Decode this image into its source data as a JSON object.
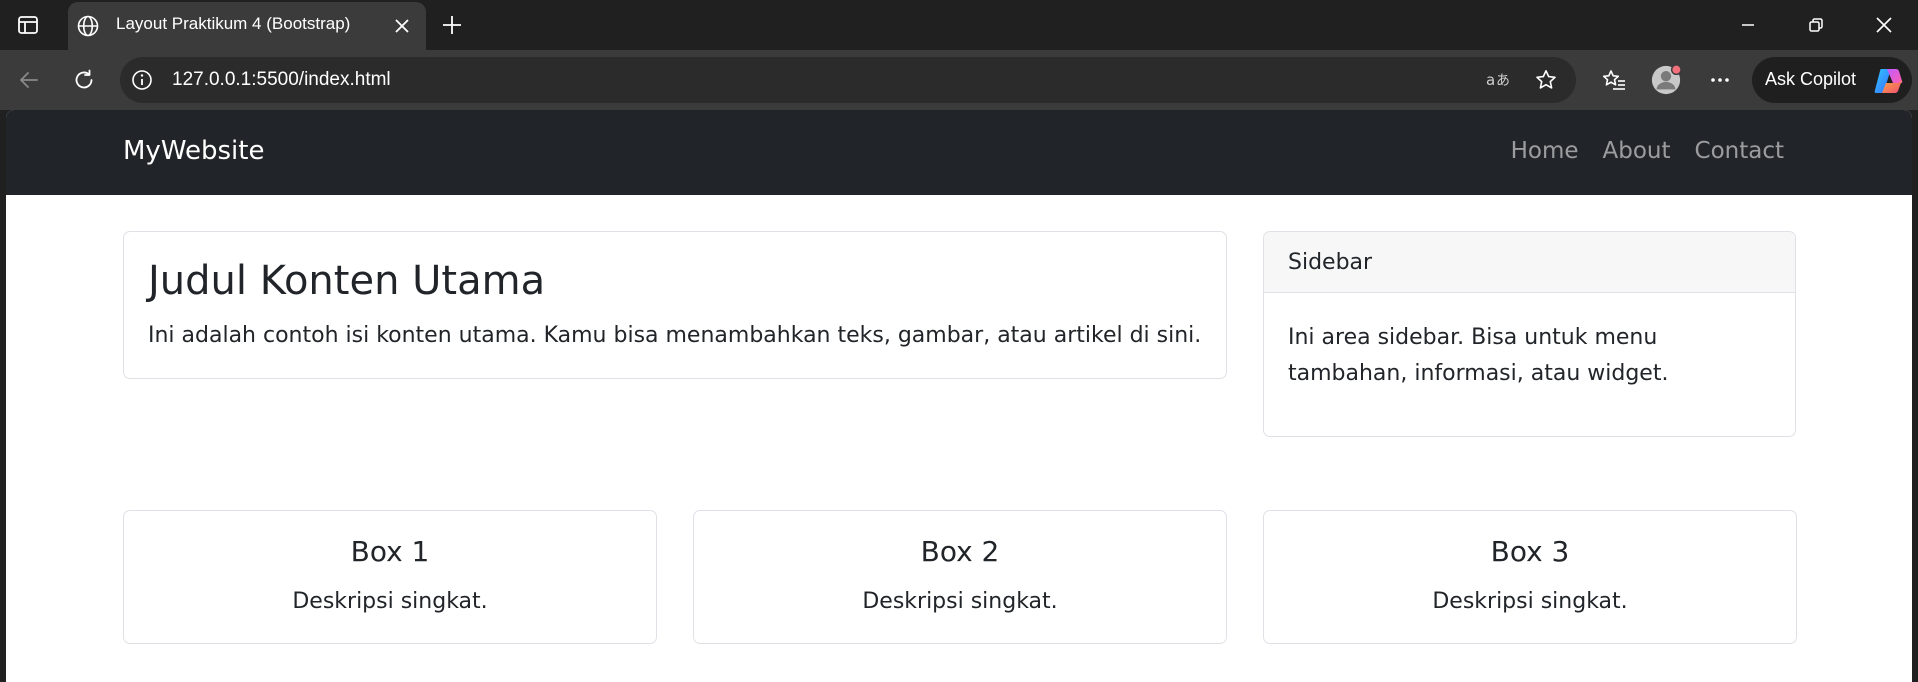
{
  "browser": {
    "tab_title": "Layout Praktikum 4 (Bootstrap)",
    "url": "127.0.0.1:5500/index.html",
    "copilot_label": "Ask Copilot",
    "icons": [
      "tab-actions-icon",
      "globe-icon",
      "close-icon",
      "plus-icon",
      "minimize-icon",
      "restore-icon",
      "window-close-icon",
      "back-icon",
      "refresh-icon",
      "info-icon",
      "read-aloud-icon",
      "favorite-star-icon",
      "favorites-icon",
      "profile-icon",
      "more-icon",
      "copilot-icon"
    ]
  },
  "navbar": {
    "brand": "MyWebsite",
    "links": [
      "Home",
      "About",
      "Contact"
    ],
    "bg_color": "#212529"
  },
  "main": {
    "title": "Judul Konten Utama",
    "text": "Ini adalah contoh isi konten utama. Kamu bisa menambahkan teks, gambar, atau artikel di sini."
  },
  "sidebar": {
    "header": "Sidebar",
    "text": "Ini area sidebar. Bisa untuk menu tambahan, informasi, atau widget."
  },
  "boxes": [
    {
      "title": "Box 1",
      "text": "Deskripsi singkat."
    },
    {
      "title": "Box 2",
      "text": "Deskripsi singkat."
    },
    {
      "title": "Box 3",
      "text": "Deskripsi singkat."
    }
  ]
}
